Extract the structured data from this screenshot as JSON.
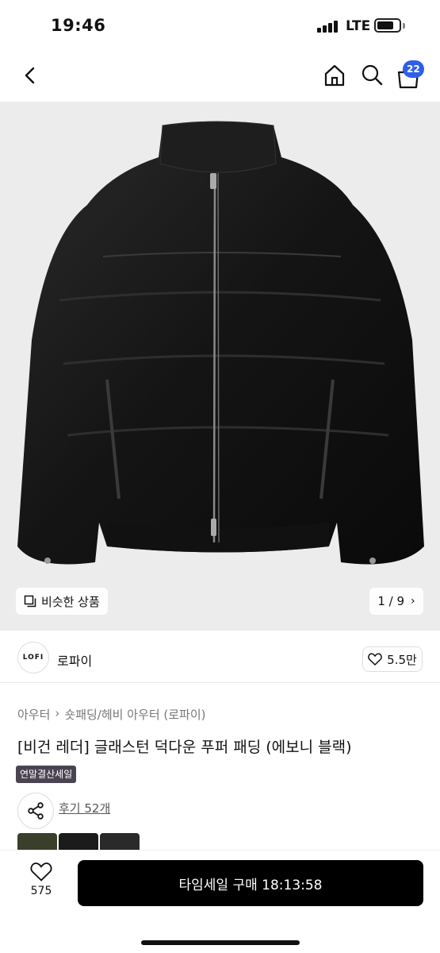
{
  "status": {
    "time": "19:46",
    "network": "LTE"
  },
  "nav": {
    "cart_count": "22"
  },
  "gallery": {
    "similar_label": "비슷한 상품",
    "counter": "1 / 9"
  },
  "brand": {
    "logo_text": "LOFI",
    "name": "로파이",
    "likes": "5.5만"
  },
  "product": {
    "breadcrumb": [
      "아우터",
      "숏패딩/헤비 아우터 (로파이)"
    ],
    "title": "[비건 레더] 글래스턴 덕다운 푸퍼 패딩 (에보니 블랙)",
    "sale_tag": "연말결산세일",
    "review_link": "후기 52개"
  },
  "color_options": [
    {
      "color": "#3a3f2c"
    },
    {
      "color": "#1b1b1b"
    },
    {
      "color": "#2a2a2a"
    }
  ],
  "bottom": {
    "wish_count": "575",
    "buy_label": "타임세일 구매 18:13:58"
  },
  "colors": {
    "accent": "#2f5fe8",
    "button": "#000000",
    "sale_tag": "#4a4452"
  }
}
